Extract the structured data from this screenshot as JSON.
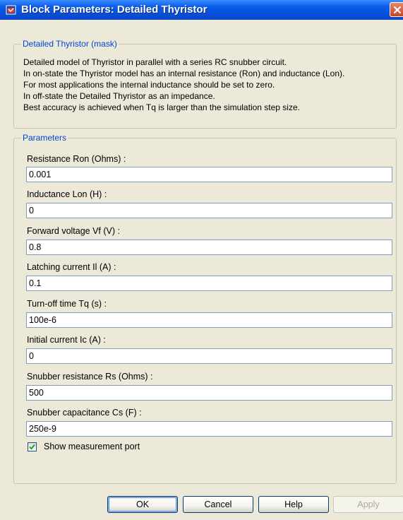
{
  "window": {
    "title": "Block Parameters: Detailed Thyristor"
  },
  "description_group": {
    "legend": "Detailed Thyristor (mask)",
    "lines": [
      "Detailed model of Thyristor in parallel with a series RC snubber circuit.",
      "In on-state the Thyristor model  has an internal resistance (Ron) and inductance (Lon).",
      "For most applications the internal inductance should be set to zero.",
      "In off-state the Detailed Thyristor  as an impedance.",
      "Best accuracy is achieved when Tq is larger than the simulation step size."
    ]
  },
  "parameters_group": {
    "legend": "Parameters",
    "fields": [
      {
        "label": "Resistance Ron (Ohms) :",
        "value": "0.001"
      },
      {
        "label": "Inductance Lon (H) :",
        "value": "0"
      },
      {
        "label": "Forward voltage Vf (V) :",
        "value": "0.8"
      },
      {
        "label": "Latching current Il (A) :",
        "value": "0.1"
      },
      {
        "label": "Turn-off time Tq (s) :",
        "value": "100e-6"
      },
      {
        "label": "Initial current Ic (A) :",
        "value": "0"
      },
      {
        "label": "Snubber resistance Rs (Ohms) :",
        "value": "500"
      },
      {
        "label": "Snubber capacitance Cs (F) :",
        "value": "250e-9"
      }
    ],
    "checkbox": {
      "label": "Show measurement port",
      "checked": true
    }
  },
  "buttons": {
    "ok": "OK",
    "cancel": "Cancel",
    "help": "Help",
    "apply": "Apply"
  },
  "colors": {
    "titlebar": "#0A5BEA",
    "legend_text": "#0046D5",
    "dialog_bg": "#ECE9D8",
    "input_border": "#7F9DB9"
  },
  "icons": {
    "window": "simulink-block-icon",
    "close": "close-icon",
    "check": "checkmark-icon"
  }
}
